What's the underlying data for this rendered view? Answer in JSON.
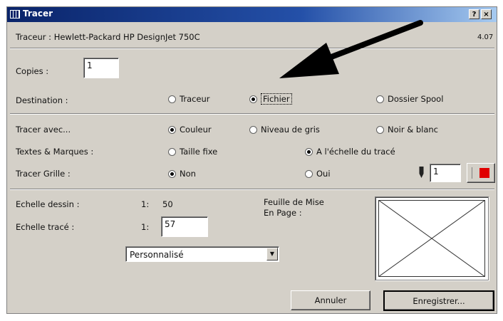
{
  "window": {
    "title": "Tracer",
    "help_label": "?",
    "close_label": "×"
  },
  "plotter": {
    "label": "Traceur : Hewlett-Packard HP DesignJet 750C",
    "version": "4.07"
  },
  "copies": {
    "label": "Copies :",
    "value": "1"
  },
  "destination": {
    "label": "Destination :",
    "options": [
      "Traceur",
      "Fichier",
      "Dossier Spool"
    ],
    "selected": "Fichier"
  },
  "plot_with": {
    "label": "Tracer avec...",
    "options": [
      "Couleur",
      "Niveau de gris",
      "Noir & blanc"
    ],
    "selected": "Couleur"
  },
  "text_marks": {
    "label": "Textes & Marques :",
    "options": [
      "Taille fixe",
      "A l'échelle du tracé"
    ],
    "selected": "A l'échelle du tracé"
  },
  "plot_grid": {
    "label": "Tracer Grille :",
    "options": [
      "Non",
      "Oui"
    ],
    "selected": "Non",
    "pen_value": "1",
    "pen_color": "#e00000"
  },
  "scales": {
    "drawing_label": "Echelle dessin :",
    "drawing_prefix": "1:",
    "drawing_value": "50",
    "plot_label": "Echelle tracé :",
    "plot_prefix": "1:",
    "plot_value": "57",
    "preset": "Personnalisé"
  },
  "page_setup": {
    "line1": "Feuille de Mise",
    "line2": "En Page :"
  },
  "buttons": {
    "cancel": "Annuler",
    "save": "Enregistrer..."
  }
}
